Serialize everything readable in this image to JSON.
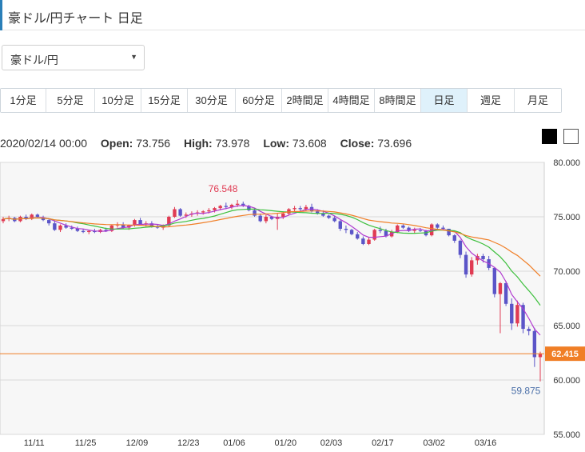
{
  "title": "豪ドル/円チャート 日足",
  "pair_select": {
    "value": "豪ドル/円"
  },
  "timeframes": [
    "1分足",
    "5分足",
    "10分足",
    "15分足",
    "30分足",
    "60分足",
    "2時間足",
    "4時間足",
    "8時間足",
    "日足",
    "週足",
    "月足"
  ],
  "active_timeframe": "日足",
  "ohlc": {
    "datetime": "2020/02/14 00:00",
    "open_label": "Open:",
    "open": "73.756",
    "high_label": "High:",
    "high": "73.978",
    "low_label": "Low:",
    "low": "73.608",
    "close_label": "Close:",
    "close": "73.696"
  },
  "chart_data": {
    "type": "candlestick",
    "y_ticks": [
      "80.000",
      "75.000",
      "70.000",
      "65.000",
      "60.000",
      "55.000"
    ],
    "ylim": [
      55,
      80
    ],
    "x_ticks": [
      "11/11",
      "11/25",
      "12/09",
      "12/23",
      "01/06",
      "01/20",
      "02/03",
      "02/17",
      "03/02",
      "03/16"
    ],
    "high_annotation": "76.548",
    "low_annotation": "59.875",
    "current_price": "62.415",
    "colors": {
      "up": "#e03b53",
      "down": "#5b55c8",
      "ma_short": "#b03ad0",
      "ma_mid": "#3cbf3c",
      "ma_long": "#f07e26",
      "price_line": "#f07e26"
    },
    "candles": [
      [
        74.6,
        75.0,
        74.4,
        74.8
      ],
      [
        74.8,
        75.1,
        74.6,
        74.9
      ],
      [
        74.9,
        75.0,
        74.5,
        74.6
      ],
      [
        74.6,
        75.1,
        74.5,
        75.0
      ],
      [
        75.0,
        75.2,
        74.7,
        74.8
      ],
      [
        74.8,
        75.3,
        74.7,
        75.2
      ],
      [
        75.2,
        75.3,
        74.9,
        75.0
      ],
      [
        74.9,
        75.1,
        74.6,
        74.7
      ],
      [
        74.7,
        74.8,
        74.2,
        74.4
      ],
      [
        74.4,
        74.6,
        73.7,
        73.8
      ],
      [
        73.8,
        74.3,
        73.6,
        74.2
      ],
      [
        74.2,
        74.4,
        73.9,
        74.0
      ],
      [
        74.0,
        74.2,
        73.8,
        73.9
      ],
      [
        73.9,
        74.1,
        73.6,
        73.7
      ],
      [
        73.7,
        73.9,
        73.5,
        73.6
      ],
      [
        73.6,
        73.8,
        73.4,
        73.7
      ],
      [
        73.7,
        73.9,
        73.5,
        73.6
      ],
      [
        73.6,
        73.9,
        73.5,
        73.8
      ],
      [
        73.8,
        74.0,
        73.6,
        73.7
      ],
      [
        73.7,
        74.3,
        73.6,
        74.2
      ],
      [
        74.2,
        74.5,
        74.0,
        74.3
      ],
      [
        74.3,
        74.5,
        73.9,
        74.0
      ],
      [
        74.0,
        74.3,
        73.8,
        74.2
      ],
      [
        74.2,
        74.8,
        74.1,
        74.7
      ],
      [
        74.7,
        74.9,
        74.2,
        74.3
      ],
      [
        74.3,
        74.6,
        74.1,
        74.4
      ],
      [
        74.4,
        74.6,
        74.0,
        74.1
      ],
      [
        74.1,
        74.3,
        73.9,
        74.0
      ],
      [
        74.0,
        74.3,
        73.8,
        74.2
      ],
      [
        74.2,
        75.1,
        74.1,
        75.0
      ],
      [
        75.0,
        75.9,
        74.9,
        75.7
      ],
      [
        75.7,
        75.8,
        75.0,
        75.1
      ],
      [
        75.1,
        75.4,
        74.9,
        75.2
      ],
      [
        75.2,
        75.5,
        75.0,
        75.3
      ],
      [
        75.3,
        75.6,
        75.1,
        75.4
      ],
      [
        75.4,
        75.6,
        75.2,
        75.5
      ],
      [
        75.5,
        75.8,
        75.3,
        75.6
      ],
      [
        75.6,
        75.9,
        75.4,
        75.8
      ],
      [
        75.8,
        76.1,
        75.6,
        76.0
      ],
      [
        76.0,
        76.3,
        75.7,
        75.9
      ],
      [
        75.9,
        76.2,
        75.7,
        76.1
      ],
      [
        76.1,
        76.548,
        75.9,
        76.2
      ],
      [
        76.2,
        76.4,
        75.9,
        76.0
      ],
      [
        76.0,
        76.1,
        75.5,
        75.6
      ],
      [
        75.6,
        75.8,
        75.0,
        75.1
      ],
      [
        75.1,
        75.3,
        74.5,
        74.6
      ],
      [
        74.6,
        75.2,
        74.4,
        75.0
      ],
      [
        75.0,
        75.1,
        74.7,
        74.8
      ],
      [
        74.8,
        75.3,
        73.8,
        75.0
      ],
      [
        75.0,
        75.5,
        74.8,
        75.3
      ],
      [
        75.3,
        75.8,
        75.1,
        75.7
      ],
      [
        75.7,
        76.0,
        75.5,
        75.8
      ],
      [
        75.8,
        76.0,
        75.5,
        75.7
      ],
      [
        75.7,
        76.1,
        75.5,
        75.9
      ],
      [
        75.9,
        76.2,
        75.4,
        75.5
      ],
      [
        75.5,
        75.7,
        75.2,
        75.3
      ],
      [
        75.3,
        75.6,
        75.0,
        75.1
      ],
      [
        75.1,
        75.2,
        74.8,
        74.9
      ],
      [
        74.9,
        75.1,
        74.5,
        74.6
      ],
      [
        74.6,
        74.7,
        73.7,
        73.9
      ],
      [
        73.9,
        74.2,
        73.5,
        73.8
      ],
      [
        73.8,
        73.9,
        73.3,
        73.4
      ],
      [
        73.4,
        73.6,
        72.9,
        73.0
      ],
      [
        73.0,
        73.2,
        72.4,
        72.5
      ],
      [
        72.5,
        73.1,
        72.4,
        72.9
      ],
      [
        72.9,
        73.9,
        72.8,
        73.8
      ],
      [
        73.8,
        74.1,
        73.5,
        73.7
      ],
      [
        73.7,
        73.9,
        73.1,
        73.2
      ],
      [
        73.2,
        73.8,
        73.1,
        73.6
      ],
      [
        73.6,
        74.3,
        73.5,
        74.2
      ],
      [
        74.2,
        74.3,
        73.9,
        74.0
      ],
      [
        74.0,
        74.1,
        73.6,
        73.7
      ],
      [
        73.7,
        74.0,
        73.5,
        73.8
      ],
      [
        73.756,
        73.978,
        73.608,
        73.696
      ],
      [
        73.7,
        73.8,
        73.2,
        73.3
      ],
      [
        73.3,
        74.4,
        73.2,
        74.3
      ],
      [
        74.3,
        74.4,
        73.9,
        74.0
      ],
      [
        74.0,
        74.2,
        73.8,
        73.9
      ],
      [
        73.9,
        73.9,
        73.2,
        73.3
      ],
      [
        73.3,
        73.4,
        72.6,
        72.8
      ],
      [
        72.8,
        72.9,
        71.2,
        71.5
      ],
      [
        71.5,
        71.8,
        69.4,
        69.7
      ],
      [
        69.7,
        71.3,
        69.5,
        71.0
      ],
      [
        71.0,
        71.6,
        70.6,
        71.4
      ],
      [
        71.4,
        71.6,
        70.8,
        71.1
      ],
      [
        71.1,
        71.4,
        70.1,
        70.3
      ],
      [
        70.3,
        70.4,
        67.6,
        67.9
      ],
      [
        67.9,
        69.0,
        64.3,
        68.9
      ],
      [
        68.9,
        69.1,
        66.8,
        67.0
      ],
      [
        67.0,
        67.5,
        64.6,
        65.2
      ],
      [
        65.2,
        67.3,
        64.9,
        66.9
      ],
      [
        66.9,
        67.1,
        64.3,
        64.7
      ],
      [
        64.7,
        64.9,
        64.1,
        64.5
      ],
      [
        64.5,
        64.8,
        61.2,
        62.1
      ],
      [
        62.1,
        62.6,
        59.875,
        62.415
      ]
    ]
  }
}
